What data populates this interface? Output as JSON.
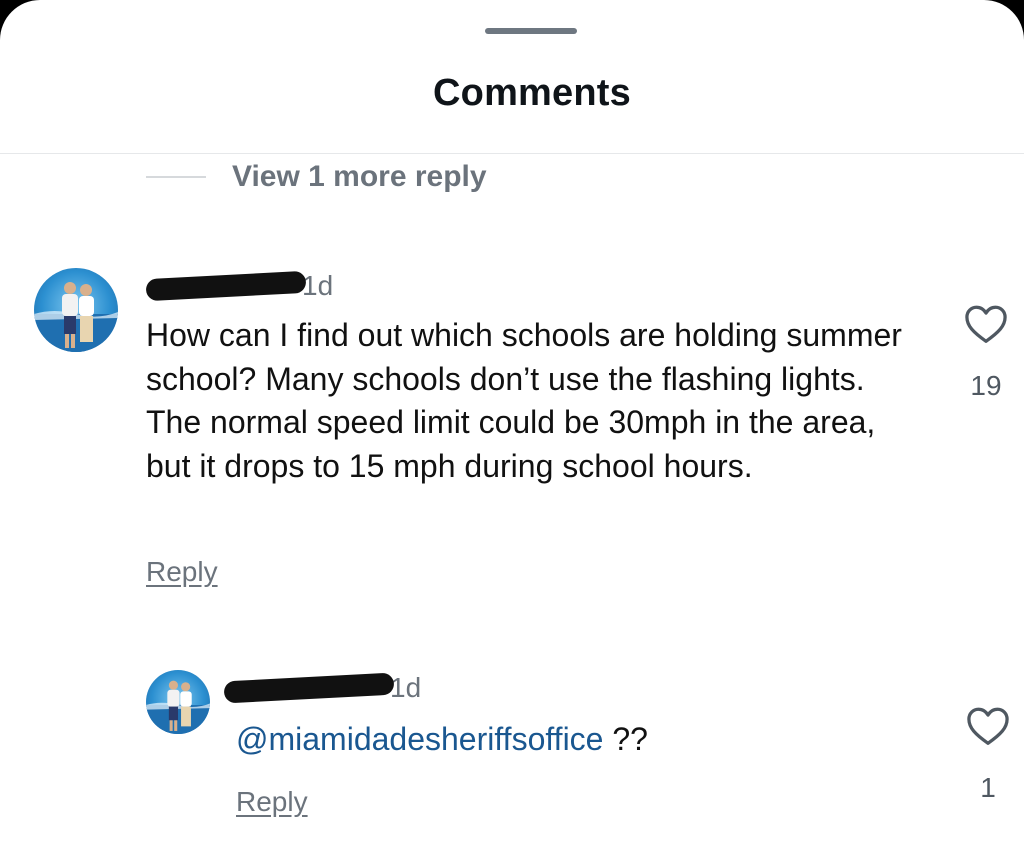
{
  "sheet": {
    "title": "Comments"
  },
  "thread": {
    "view_more_label": "View 1 more reply"
  },
  "comments": [
    {
      "avatar": "user-avatar-photo",
      "time": "1d",
      "text": "How can I find out which schools are holding summer school? Many schools don’t use the flashing lights. The normal speed limit could be 30mph in the area, but it drops to 15 mph during school hours.",
      "reply_label": "Reply",
      "like_icon": "heart-outline-icon",
      "like_count": "19"
    },
    {
      "avatar": "user-avatar-photo",
      "time": "1d",
      "mention": "@miamidadesheriffsoffice",
      "text": " ??",
      "reply_label": "Reply",
      "like_icon": "heart-outline-icon",
      "like_count": "1"
    }
  ],
  "colors": {
    "text": "#111111",
    "muted": "#6b737c",
    "mention": "#1a5790",
    "divider": "#e6e8ea"
  }
}
